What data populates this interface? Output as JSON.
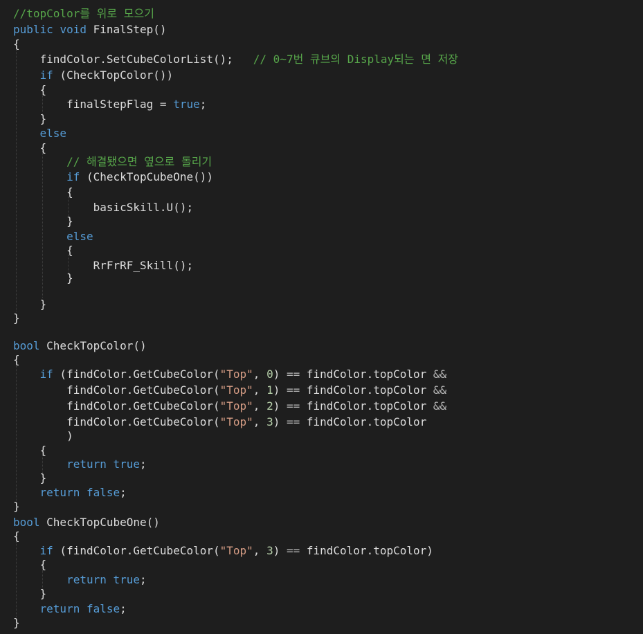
{
  "editor": {
    "colors": {
      "background": "#1e1e1e",
      "text": "#dcdcdc",
      "keyword": "#569cd6",
      "comment": "#57a64a",
      "string": "#d69d85",
      "number": "#b5cea8",
      "operator": "#b4b4b4"
    },
    "lines": [
      {
        "tokens": [
          {
            "t": "//topColor를 위로 모으기",
            "c": "cm"
          }
        ]
      },
      {
        "tokens": [
          {
            "t": "public",
            "c": "kw"
          },
          {
            "t": " "
          },
          {
            "t": "void",
            "c": "kw"
          },
          {
            "t": " FinalStep()"
          }
        ]
      },
      {
        "tokens": [
          {
            "t": "{"
          }
        ]
      },
      {
        "tokens": [
          {
            "t": "    findColor.SetCubeColorList();   "
          },
          {
            "t": "// 0~7번 큐브의 Display되는 면 저장",
            "c": "cm"
          }
        ]
      },
      {
        "tokens": [
          {
            "t": "    "
          },
          {
            "t": "if",
            "c": "kw"
          },
          {
            "t": " (CheckTopColor())"
          }
        ]
      },
      {
        "tokens": [
          {
            "t": "    {"
          }
        ]
      },
      {
        "tokens": [
          {
            "t": "        finalStepFlag "
          },
          {
            "t": "=",
            "c": "op"
          },
          {
            "t": " "
          },
          {
            "t": "true",
            "c": "kw"
          },
          {
            "t": ";"
          }
        ]
      },
      {
        "tokens": [
          {
            "t": "    }"
          }
        ]
      },
      {
        "tokens": [
          {
            "t": "    "
          },
          {
            "t": "else",
            "c": "kw"
          }
        ]
      },
      {
        "tokens": [
          {
            "t": "    {"
          }
        ]
      },
      {
        "tokens": [
          {
            "t": "        "
          },
          {
            "t": "// 해결됐으면 옆으로 돌리기",
            "c": "cm"
          }
        ]
      },
      {
        "tokens": [
          {
            "t": "        "
          },
          {
            "t": "if",
            "c": "kw"
          },
          {
            "t": " (CheckTopCubeOne())"
          }
        ]
      },
      {
        "tokens": [
          {
            "t": "        {"
          }
        ]
      },
      {
        "tokens": [
          {
            "t": "            basicSkill.U();"
          }
        ]
      },
      {
        "tokens": [
          {
            "t": "        }"
          }
        ]
      },
      {
        "tokens": [
          {
            "t": "        "
          },
          {
            "t": "else",
            "c": "kw"
          }
        ]
      },
      {
        "tokens": [
          {
            "t": "        {"
          }
        ]
      },
      {
        "tokens": [
          {
            "t": "            RrFrRF_Skill();"
          }
        ]
      },
      {
        "tokens": [
          {
            "t": "        }"
          }
        ]
      },
      {
        "tokens": []
      },
      {
        "tokens": [
          {
            "t": "    }"
          }
        ]
      },
      {
        "tokens": [
          {
            "t": "}"
          }
        ]
      },
      {
        "tokens": []
      },
      {
        "tokens": [
          {
            "t": "bool",
            "c": "kw"
          },
          {
            "t": " CheckTopColor()"
          }
        ]
      },
      {
        "tokens": [
          {
            "t": "{"
          }
        ]
      },
      {
        "tokens": [
          {
            "t": "    "
          },
          {
            "t": "if",
            "c": "kw"
          },
          {
            "t": " (findColor.GetCubeColor("
          },
          {
            "t": "\"Top\"",
            "c": "str"
          },
          {
            "t": ", "
          },
          {
            "t": "0",
            "c": "num"
          },
          {
            "t": ") "
          },
          {
            "t": "==",
            "c": "op"
          },
          {
            "t": " findColor.topColor "
          },
          {
            "t": "&&",
            "c": "op"
          }
        ]
      },
      {
        "tokens": [
          {
            "t": "        findColor.GetCubeColor("
          },
          {
            "t": "\"Top\"",
            "c": "str"
          },
          {
            "t": ", "
          },
          {
            "t": "1",
            "c": "num"
          },
          {
            "t": ") "
          },
          {
            "t": "==",
            "c": "op"
          },
          {
            "t": " findColor.topColor "
          },
          {
            "t": "&&",
            "c": "op"
          }
        ]
      },
      {
        "tokens": [
          {
            "t": "        findColor.GetCubeColor("
          },
          {
            "t": "\"Top\"",
            "c": "str"
          },
          {
            "t": ", "
          },
          {
            "t": "2",
            "c": "num"
          },
          {
            "t": ") "
          },
          {
            "t": "==",
            "c": "op"
          },
          {
            "t": " findColor.topColor "
          },
          {
            "t": "&&",
            "c": "op"
          }
        ]
      },
      {
        "tokens": [
          {
            "t": "        findColor.GetCubeColor("
          },
          {
            "t": "\"Top\"",
            "c": "str"
          },
          {
            "t": ", "
          },
          {
            "t": "3",
            "c": "num"
          },
          {
            "t": ") "
          },
          {
            "t": "==",
            "c": "op"
          },
          {
            "t": " findColor.topColor"
          }
        ]
      },
      {
        "tokens": [
          {
            "t": "        )"
          }
        ]
      },
      {
        "tokens": [
          {
            "t": "    {"
          }
        ]
      },
      {
        "tokens": [
          {
            "t": "        "
          },
          {
            "t": "return",
            "c": "kw"
          },
          {
            "t": " "
          },
          {
            "t": "true",
            "c": "kw"
          },
          {
            "t": ";"
          }
        ]
      },
      {
        "tokens": [
          {
            "t": "    }"
          }
        ]
      },
      {
        "tokens": [
          {
            "t": "    "
          },
          {
            "t": "return",
            "c": "kw"
          },
          {
            "t": " "
          },
          {
            "t": "false",
            "c": "kw"
          },
          {
            "t": ";"
          }
        ]
      },
      {
        "tokens": [
          {
            "t": "}"
          }
        ]
      },
      {
        "tokens": [
          {
            "t": "bool",
            "c": "kw"
          },
          {
            "t": " CheckTopCubeOne()"
          }
        ]
      },
      {
        "tokens": [
          {
            "t": "{"
          }
        ]
      },
      {
        "tokens": [
          {
            "t": "    "
          },
          {
            "t": "if",
            "c": "kw"
          },
          {
            "t": " (findColor.GetCubeColor("
          },
          {
            "t": "\"Top\"",
            "c": "str"
          },
          {
            "t": ", "
          },
          {
            "t": "3",
            "c": "num"
          },
          {
            "t": ") "
          },
          {
            "t": "==",
            "c": "op"
          },
          {
            "t": " findColor.topColor)"
          }
        ]
      },
      {
        "tokens": [
          {
            "t": "    {"
          }
        ]
      },
      {
        "tokens": [
          {
            "t": "        "
          },
          {
            "t": "return",
            "c": "kw"
          },
          {
            "t": " "
          },
          {
            "t": "true",
            "c": "kw"
          },
          {
            "t": ";"
          }
        ]
      },
      {
        "tokens": [
          {
            "t": "    }"
          }
        ]
      },
      {
        "tokens": [
          {
            "t": "    "
          },
          {
            "t": "return",
            "c": "kw"
          },
          {
            "t": " "
          },
          {
            "t": "false",
            "c": "kw"
          },
          {
            "t": ";"
          }
        ]
      },
      {
        "tokens": [
          {
            "t": "}"
          }
        ]
      }
    ]
  }
}
